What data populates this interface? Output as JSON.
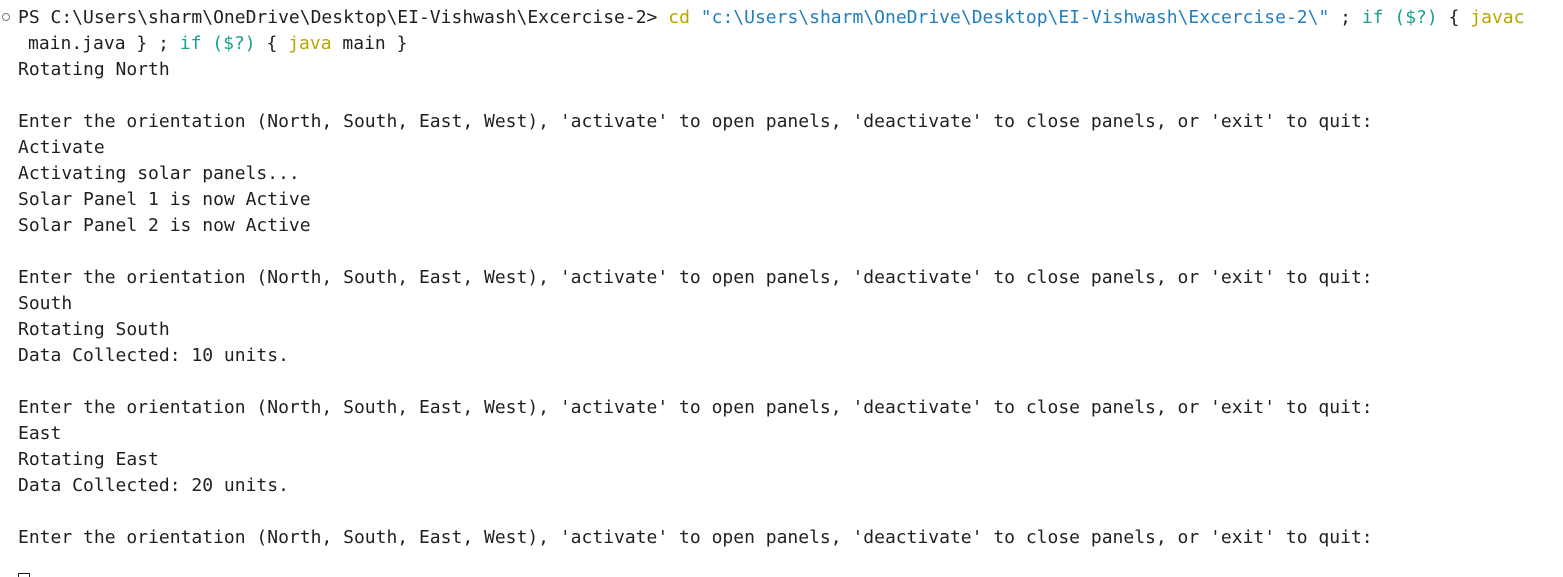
{
  "terminal": {
    "prompt": {
      "ps": "PS C:\\Users\\sharm\\OneDrive\\Desktop\\EI-Vishwash\\Excercise-2>",
      "cd": "cd",
      "path": "\"c:\\Users\\sharm\\OneDrive\\Desktop\\EI-Vishwash\\Excercise-2\\\"",
      "sep1": ";",
      "if1": "if",
      "cond1": "($?)",
      "brace_open1": "{",
      "javac": "javac",
      "file": "main.java",
      "brace_close1": "}",
      "sep2": ";",
      "if2": "if",
      "cond2": "($?)",
      "brace_open2": "{",
      "java": "java",
      "main": "main",
      "brace_close2": "}"
    },
    "lines": [
      "Rotating North",
      "",
      "Enter the orientation (North, South, East, West), 'activate' to open panels, 'deactivate' to close panels, or 'exit' to quit:",
      "Activate",
      "Activating solar panels...",
      "Solar Panel 1 is now Active",
      "Solar Panel 2 is now Active",
      "",
      "Enter the orientation (North, South, East, West), 'activate' to open panels, 'deactivate' to close panels, or 'exit' to quit:",
      "South",
      "Rotating South",
      "Data Collected: 10 units.",
      "",
      "Enter the orientation (North, South, East, West), 'activate' to open panels, 'deactivate' to close panels, or 'exit' to quit:",
      "East",
      "Rotating East",
      "Data Collected: 20 units.",
      "",
      "Enter the orientation (North, South, East, West), 'activate' to open panels, 'deactivate' to close panels, or 'exit' to quit:"
    ]
  },
  "colors": {
    "background": "#ffffff",
    "text": "#1f1f1f",
    "keyword": "#b8a600",
    "string": "#1f7fc0",
    "control": "#1aa08c"
  }
}
